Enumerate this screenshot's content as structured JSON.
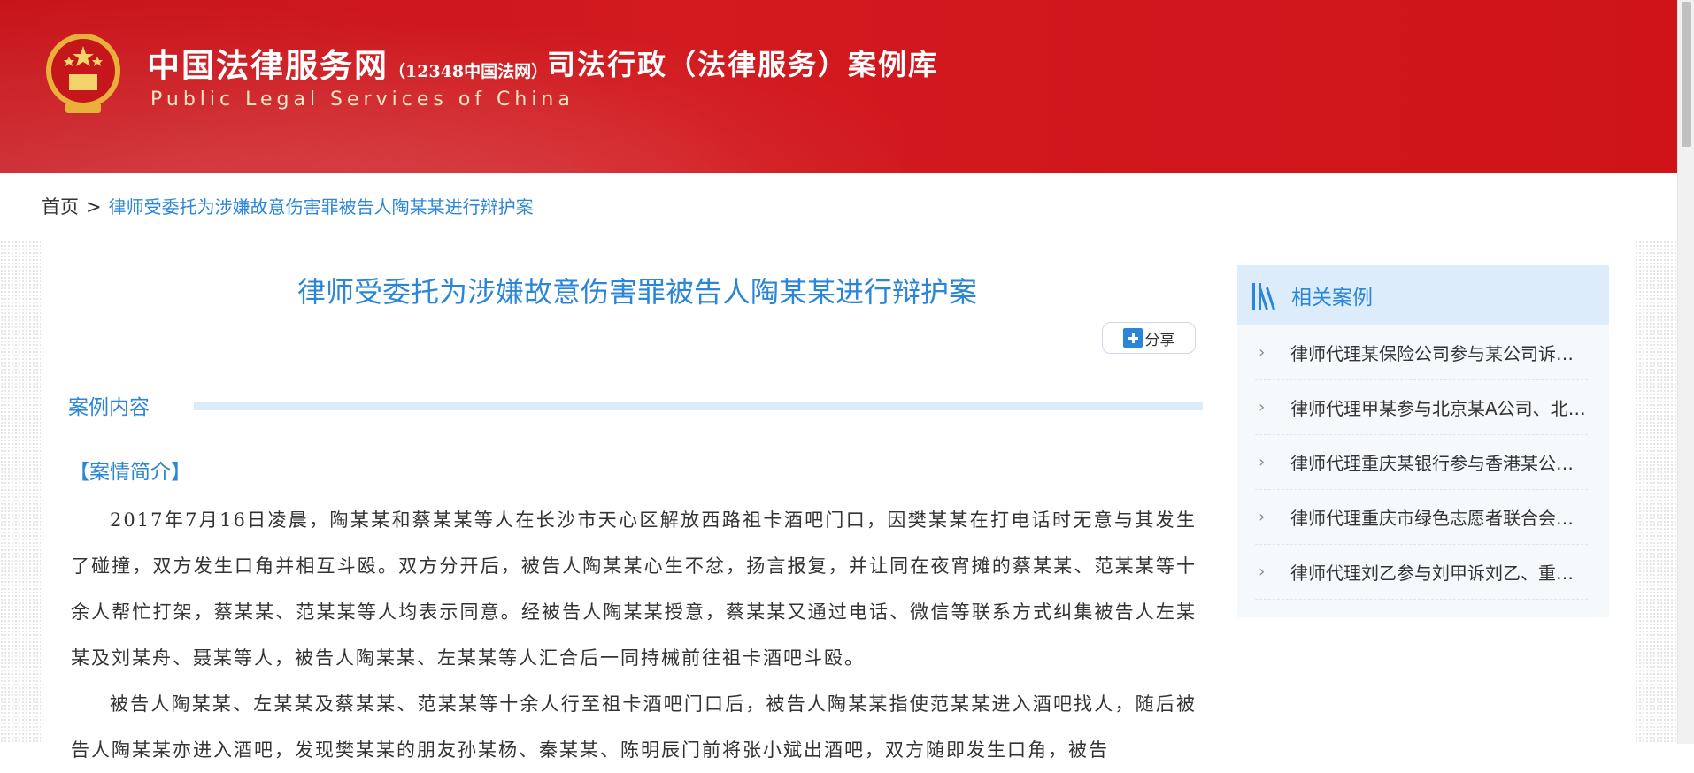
{
  "header": {
    "site_title": "中国法律服务网",
    "site_title_suffix": "（12348中国法网）",
    "site_subtitle": "Public Legal Services of China",
    "library_title": "司法行政（法律服务）案例库"
  },
  "breadcrumb": {
    "home": "首页",
    "separator": ">",
    "current": "律师受委托为涉嫌故意伤害罪被告人陶某某进行辩护案"
  },
  "article": {
    "title": "律师受委托为涉嫌故意伤害罪被告人陶某某进行辩护案",
    "share_label": "分享",
    "section_label": "案例内容",
    "case_heading": "【案情简介】",
    "paragraphs": [
      "2017年7月16日凌晨，陶某某和蔡某某等人在长沙市天心区解放西路祖卡酒吧门口，因樊某某在打电话时无意与其发生了碰撞，双方发生口角并相互斗殴。双方分开后，被告人陶某某心生不忿，扬言报复，并让同在夜宵摊的蔡某某、范某某等十余人帮忙打架，蔡某某、范某某等人均表示同意。经被告人陶某某授意，蔡某某又通过电话、微信等联系方式纠集被告人左某某及刘某舟、聂某等人，被告人陶某某、左某某等人汇合后一同持械前往祖卡酒吧斗殴。",
      "被告人陶某某、左某某及蔡某某、范某某等十余人行至祖卡酒吧门口后，被告人陶某某指使范某某进入酒吧找人，随后被告人陶某某亦进入酒吧，发现樊某某的朋友孙某杨、秦某某、陈明辰门前将张小斌出酒吧，双方随即发生口角，被告"
    ]
  },
  "sidebar": {
    "title": "相关案例",
    "items": [
      "律师代理某保险公司参与某公司诉某保险公司保险合同纠纷案",
      "律师代理甲某参与北京某A公司、北京某B公司合同纠纷案",
      "律师代理重庆某银行参与香港某公司借款合同纠纷案",
      "律师代理重庆市绿色志愿者联合会环境公益诉讼案",
      "律师代理刘乙参与刘甲诉刘乙、重庆某公司纠纷案"
    ]
  },
  "colors": {
    "header_red": "#cf1319",
    "accent_blue": "#2b86d8",
    "sidebar_head_bg": "#dcecfa"
  }
}
